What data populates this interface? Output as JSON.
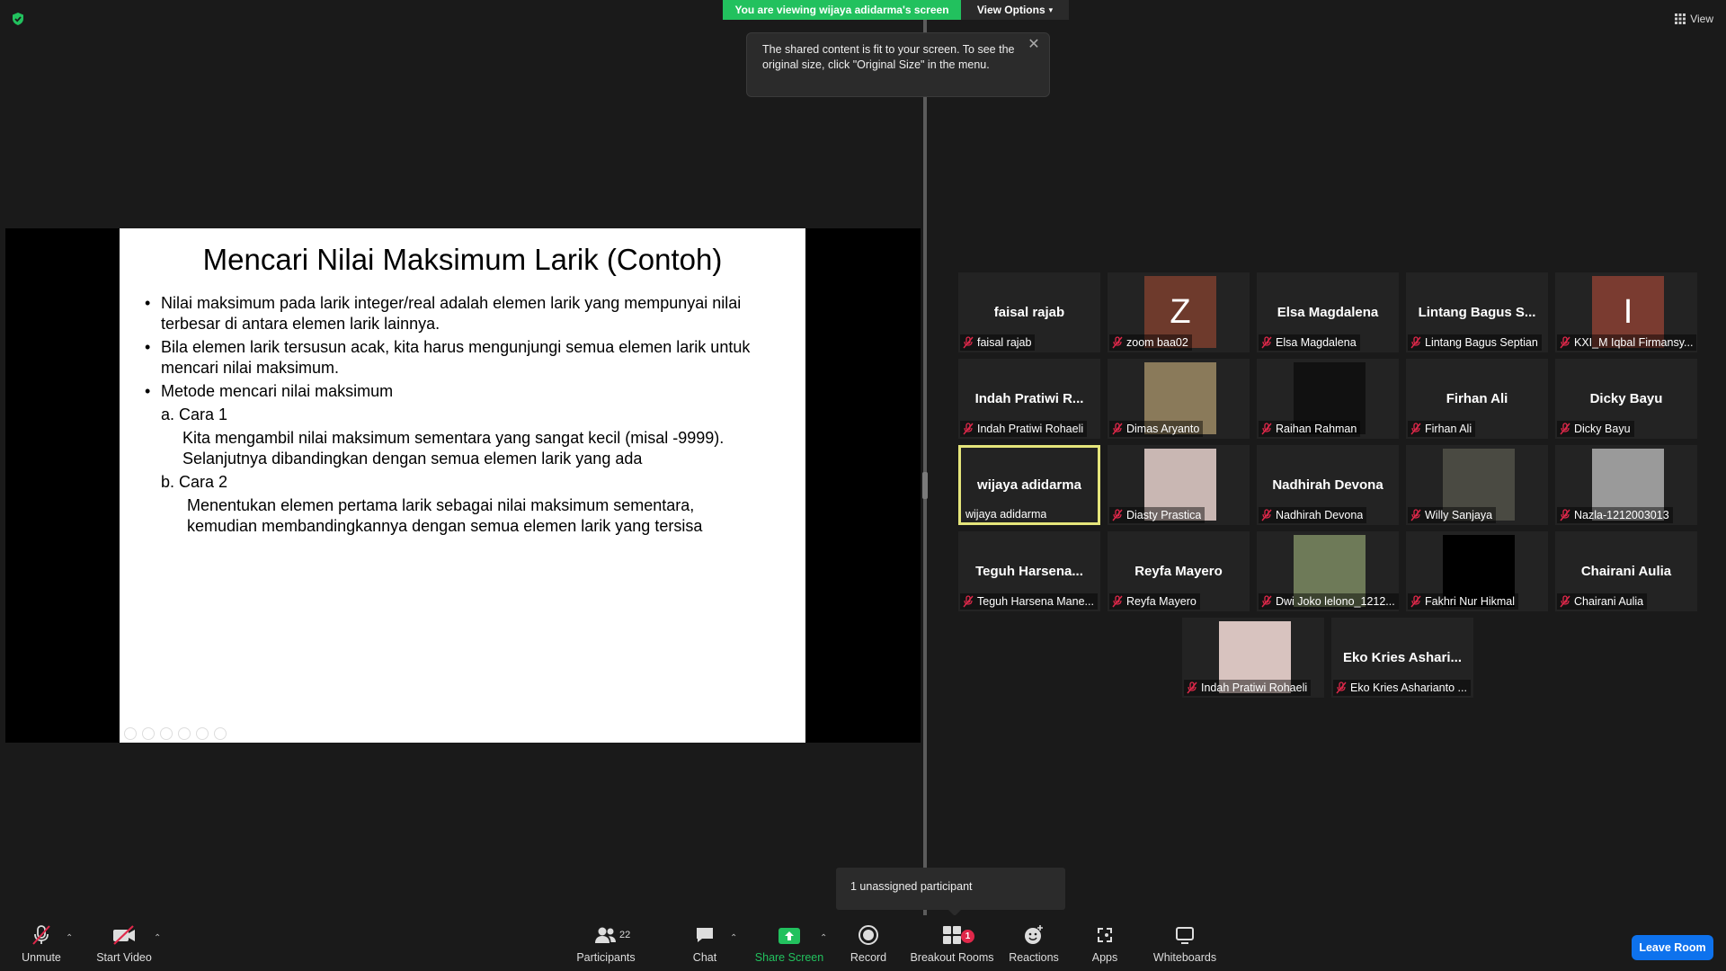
{
  "banner": {
    "viewing": "You are viewing wijaya adidarma's screen",
    "view_options": "View Options",
    "view": "View"
  },
  "tooltip": {
    "text": "The shared content is fit to your screen. To see the original size, click \"Original Size\" in the menu."
  },
  "slide": {
    "title": "Mencari Nilai Maksimum Larik (Contoh)",
    "bullet1": "Nilai maksimum pada larik integer/real adalah elemen larik yang mempunyai nilai terbesar di antara elemen larik lainnya.",
    "bullet2": "Bila elemen larik tersusun acak, kita harus mengunjungi semua elemen larik untuk mencari nilai maksimum.",
    "bullet3": "Metode mencari nilai maksimum",
    "a_label": "a. Cara 1",
    "a_text1": "Kita mengambil nilai maksimum sementara yang sangat kecil (misal -9999).",
    "a_text2": "Selanjutnya dibandingkan dengan semua elemen larik yang ada",
    "b_label": "b. Cara 2",
    "b_text1": "Menentukan elemen pertama larik sebagai nilai maksimum sementara,",
    "b_text2": "kemudian membandingkannya dengan semua elemen larik yang tersisa"
  },
  "gallery": [
    {
      "center": "faisal rajab",
      "label": "faisal rajab",
      "avatar": ""
    },
    {
      "center": "",
      "label": "zoom baa02",
      "avatar": "Z",
      "avatar_color": "#6e3a2c"
    },
    {
      "center": "Elsa Magdalena",
      "label": "Elsa Magdalena",
      "avatar": ""
    },
    {
      "center": "Lintang Bagus S...",
      "label": "Lintang Bagus Septian",
      "avatar": ""
    },
    {
      "center": "",
      "label": "KXI_M Iqbal Firmansy...",
      "avatar": "I",
      "avatar_color": "#7a3b30"
    },
    {
      "center": "Indah  Pratiwi  R...",
      "label": "Indah Pratiwi Rohaeli",
      "avatar": ""
    },
    {
      "center": "",
      "label": "Dimas Aryanto",
      "avatar": "photo",
      "avatar_color": "#8a7a5a"
    },
    {
      "center": "",
      "label": "Raihan Rahman",
      "avatar": "photo",
      "avatar_color": "#111111"
    },
    {
      "center": "Firhan Ali",
      "label": "Firhan Ali",
      "avatar": ""
    },
    {
      "center": "Dicky Bayu",
      "label": "Dicky Bayu",
      "avatar": ""
    },
    {
      "center": "wijaya adidarma",
      "label": "wijaya adidarma",
      "avatar": "",
      "active": true
    },
    {
      "center": "",
      "label": "Diasty Prastica",
      "avatar": "photo",
      "avatar_color": "#c9b7b3"
    },
    {
      "center": "Nadhirah Devona",
      "label": "Nadhirah Devona",
      "avatar": ""
    },
    {
      "center": "",
      "label": "Willy Sanjaya",
      "avatar": "photo",
      "avatar_color": "#4a4a42"
    },
    {
      "center": "",
      "label": "Nazla-1212003013",
      "avatar": "photo",
      "avatar_color": "#9a9a9a"
    },
    {
      "center": "Teguh  Harsena...",
      "label": "Teguh Harsena Mane...",
      "avatar": ""
    },
    {
      "center": "Reyfa Mayero",
      "label": "Reyfa Mayero",
      "avatar": ""
    },
    {
      "center": "",
      "label": "Dwi Joko lelono_1212...",
      "avatar": "photo",
      "avatar_color": "#6e7a58"
    },
    {
      "center": "",
      "label": "Fakhri Nur Hikmal",
      "avatar": "photo",
      "avatar_color": "#000000"
    },
    {
      "center": "Chairani Aulia",
      "label": "Chairani Aulia",
      "avatar": ""
    },
    {
      "center": "",
      "label": "Indah Pratiwi Rohaeli",
      "avatar": "photo",
      "avatar_color": "#d8c3bf"
    },
    {
      "center": "Eko Kries Ashari...",
      "label": "Eko Kries Asharianto ...",
      "avatar": ""
    }
  ],
  "unassigned": "1 unassigned participant",
  "toolbar": {
    "unmute": "Unmute",
    "start_video": "Start Video",
    "participants": "Participants",
    "participants_count": "22",
    "chat": "Chat",
    "share_screen": "Share Screen",
    "record": "Record",
    "breakout_rooms": "Breakout Rooms",
    "breakout_badge": "1",
    "reactions": "Reactions",
    "apps": "Apps",
    "whiteboards": "Whiteboards",
    "leave_room": "Leave Room"
  },
  "colors": {
    "accent_green": "#22c15e",
    "leave_blue": "#0e72ed",
    "active_border": "#e5e57b",
    "mute_red": "#e0284a"
  }
}
